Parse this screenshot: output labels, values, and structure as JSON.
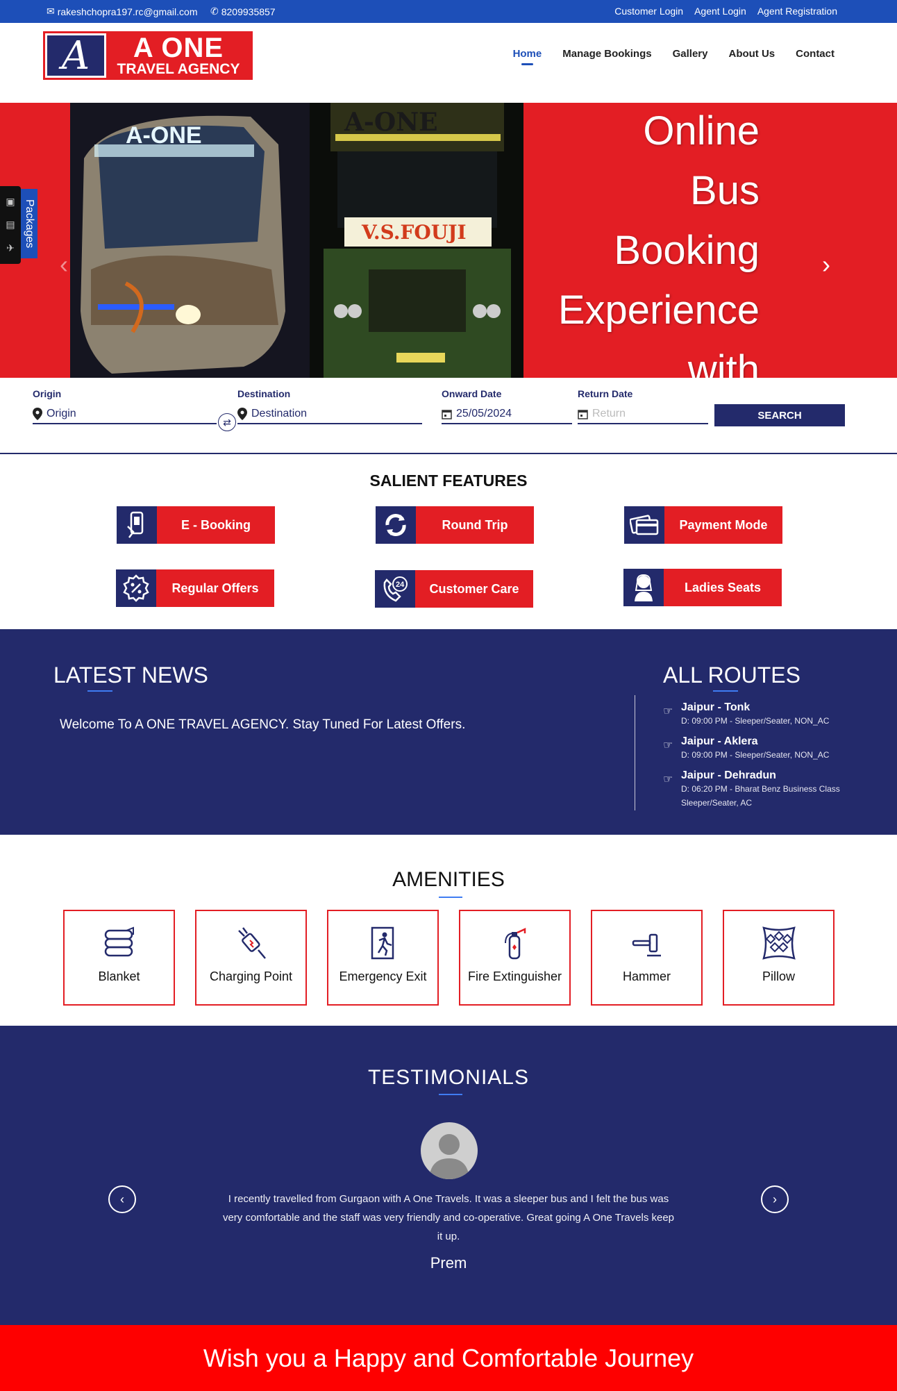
{
  "topbar": {
    "email": "rakeshchopra197.rc@gmail.com",
    "phone": "8209935857",
    "links": [
      "Customer Login",
      "Agent Login",
      "Agent Registration"
    ]
  },
  "brand": {
    "mark": "A",
    "line1": "A ONE",
    "line2": "TRAVEL AGENCY"
  },
  "nav": [
    "Home",
    "Manage Bookings",
    "Gallery",
    "About Us",
    "Contact"
  ],
  "hero": {
    "caption": [
      "Online",
      "Bus",
      "Booking",
      "Experience",
      "with"
    ],
    "bus_left_sign": "A-ONE",
    "bus_right_sign_top": "A-ONE",
    "bus_right_sign": "V.S.FOUJI"
  },
  "packages_label": "Packages",
  "search": {
    "origin_label": "Origin",
    "origin_placeholder": "Origin",
    "destination_label": "Destination",
    "destination_placeholder": "Destination",
    "onward_label": "Onward Date",
    "onward_value": "25/05/2024",
    "return_label": "Return Date",
    "return_placeholder": "Return",
    "button": "SEARCH"
  },
  "features": {
    "title": "SALIENT FEATURES",
    "items": [
      "E - Booking",
      "Round Trip",
      "Payment Mode",
      "Regular Offers",
      "Customer Care",
      "Ladies Seats"
    ]
  },
  "news": {
    "title": "LATEST NEWS",
    "text": "Welcome To A ONE TRAVEL AGENCY. Stay Tuned For Latest Offers."
  },
  "routes": {
    "title": "ALL ROUTES",
    "items": [
      {
        "name": "Jaipur - Tonk",
        "detail": "D: 09:00 PM - Sleeper/Seater, NON_AC"
      },
      {
        "name": "Jaipur - Aklera",
        "detail": "D: 09:00 PM - Sleeper/Seater, NON_AC"
      },
      {
        "name": "Jaipur - Dehradun",
        "detail": "D: 06:20 PM - Bharat Benz Business Class Sleeper/Seater, AC"
      }
    ]
  },
  "amenities": {
    "title": "AMENITIES",
    "items": [
      "Blanket",
      "Charging Point",
      "Emergency Exit",
      "Fire Extinguisher",
      "Hammer",
      "Pillow"
    ]
  },
  "testimonials": {
    "title": "TESTIMONIALS",
    "quote": "I recently travelled from Gurgaon with A One Travels. It was a sleeper bus and I felt the bus was very comfortable and the staff was very friendly and co-operative. Great going A One Travels keep it up.",
    "author": "Prem"
  },
  "footer": {
    "banner": "Wish you a Happy and Comfortable Journey"
  },
  "colors": {
    "blue_bar": "#1d4fb8",
    "navy": "#232a6b",
    "red": "#e31e24",
    "banner_red": "#fe0000"
  }
}
